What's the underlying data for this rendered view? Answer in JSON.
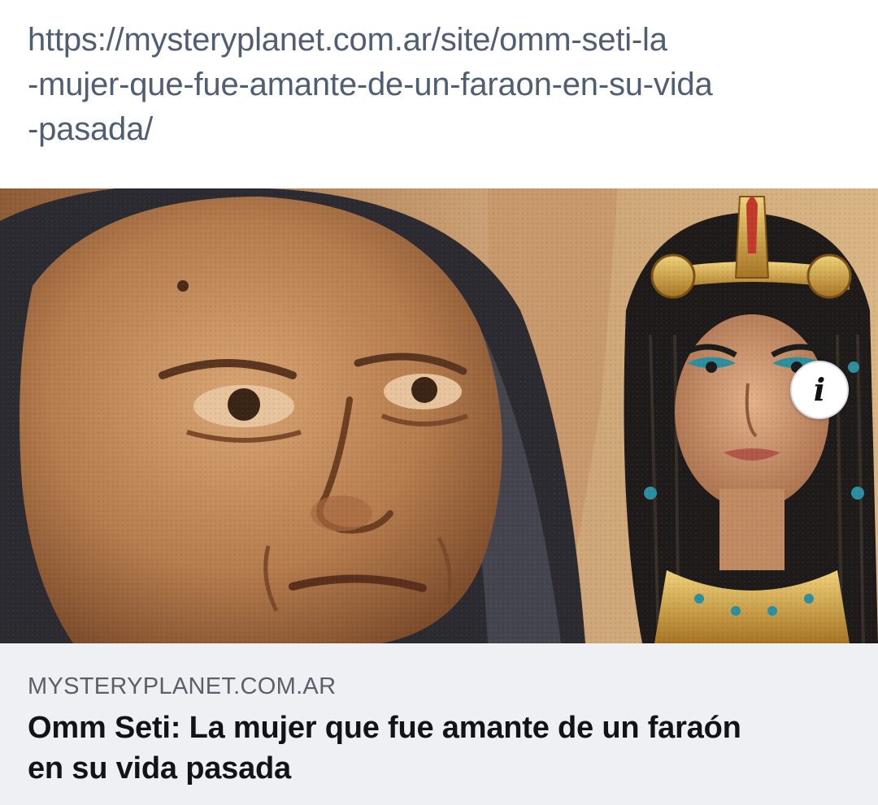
{
  "post": {
    "url_lines": [
      "https://mysteryplanet.com.ar/site/omm-seti-la",
      "-mujer-que-fue-amante-de-un-faraon-en-su-vida",
      "-pasada/"
    ]
  },
  "link_preview": {
    "image_icon": "info-icon",
    "info_label": "i",
    "domain": "MYSTERYPLANET.COM.AR",
    "headline_lines": [
      "Omm Seti: La mujer que fue amante de un faraón",
      "en su vida pasada"
    ]
  },
  "colors": {
    "url_text": "#4f5e72",
    "caption_background": "#eef0f4",
    "domain_text": "#5b6068",
    "headline_text": "#111417"
  }
}
